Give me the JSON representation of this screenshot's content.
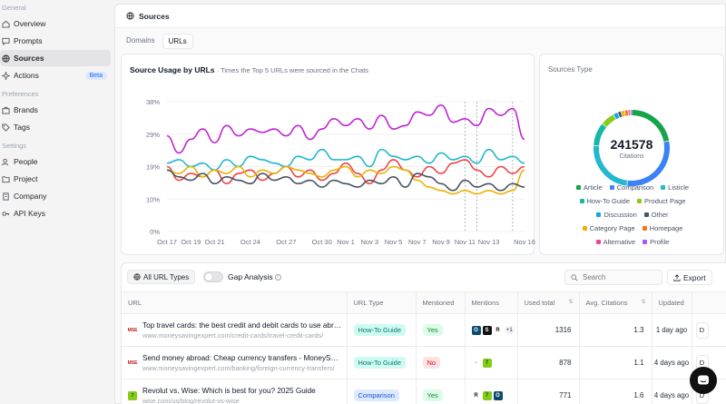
{
  "sidebar": {
    "groups": [
      {
        "label": "General",
        "items": [
          {
            "label": "Overview",
            "icon": "home-icon"
          },
          {
            "label": "Prompts",
            "icon": "chat-icon"
          },
          {
            "label": "Sources",
            "icon": "globe-icon",
            "active": true
          },
          {
            "label": "Actions",
            "icon": "sparkle-icon",
            "badge": "Beta"
          }
        ]
      },
      {
        "label": "Preferences",
        "items": [
          {
            "label": "Brands",
            "icon": "briefcase-icon"
          },
          {
            "label": "Tags",
            "icon": "tag-icon"
          }
        ]
      },
      {
        "label": "Settings",
        "items": [
          {
            "label": "People",
            "icon": "users-icon"
          },
          {
            "label": "Project",
            "icon": "folder-icon"
          },
          {
            "label": "Company",
            "icon": "building-icon"
          },
          {
            "label": "API Keys",
            "icon": "key-icon"
          }
        ]
      }
    ]
  },
  "header": {
    "title": "Sources",
    "icon": "globe-icon"
  },
  "tabs": [
    {
      "label": "Domains"
    },
    {
      "label": "URLs",
      "active": true
    }
  ],
  "usage": {
    "title": "Source Usage by URLs",
    "subtitle": " · Times the Top 5 URLs were sourced in the Chats"
  },
  "chart_data": {
    "type": "line",
    "x": [
      "Oct 17",
      "Oct 18",
      "Oct 19",
      "Oct 20",
      "Oct 21",
      "Oct 22",
      "Oct 23",
      "Oct 24",
      "Oct 25",
      "Oct 26",
      "Oct 27",
      "Oct 28",
      "Oct 29",
      "Oct 30",
      "Oct 31",
      "Nov 1",
      "Nov 2",
      "Nov 3",
      "Nov 4",
      "Nov 5",
      "Nov 6",
      "Nov 7",
      "Nov 8",
      "Nov 9",
      "Nov 10",
      "Nov 11",
      "Nov 12",
      "Nov 13",
      "Nov 14",
      "Nov 15",
      "Nov 16"
    ],
    "xticks": [
      "Oct 17",
      "Oct 19",
      "Oct 21",
      "Oct 24",
      "Oct 27",
      "Oct 30",
      "Nov 1",
      "Nov 3",
      "Nov 5",
      "Nov 7",
      "Nov 9",
      "Nov 11",
      "Nov 13",
      "Nov 16"
    ],
    "yticks": [
      "38%",
      "29%",
      "19%",
      "10%",
      "0%"
    ],
    "ylim": [
      0,
      38
    ],
    "dashed_x": [
      "Nov 11",
      "Nov 12",
      "Nov 15"
    ],
    "series": [
      {
        "color": "#c026d3",
        "values": [
          28,
          23,
          27,
          30,
          26,
          31,
          28,
          30,
          29,
          30,
          28,
          31,
          27,
          30,
          33,
          31,
          33,
          30,
          34,
          30,
          31,
          35,
          34,
          37,
          32,
          33,
          31,
          36,
          34,
          36,
          27
        ]
      },
      {
        "color": "#22b8cf",
        "values": [
          20,
          21,
          19,
          20,
          18,
          21,
          19,
          22,
          21,
          20,
          19,
          22,
          21,
          24,
          21,
          21,
          22,
          19,
          24,
          22,
          21,
          22,
          20,
          23,
          21,
          22,
          20,
          24,
          21,
          22,
          20
        ]
      },
      {
        "color": "#ef4444",
        "values": [
          19,
          15,
          17,
          16,
          18,
          14,
          17,
          18,
          15,
          17,
          19,
          16,
          18,
          15,
          17,
          20,
          17,
          14,
          18,
          21,
          18,
          16,
          19,
          17,
          20,
          21,
          18,
          16,
          19,
          17,
          19
        ]
      },
      {
        "color": "#eab308",
        "values": [
          18,
          17,
          19,
          16,
          18,
          17,
          19,
          16,
          18,
          17,
          19,
          18,
          17,
          16,
          18,
          19,
          16,
          18,
          17,
          19,
          18,
          15,
          13,
          12,
          11,
          12,
          11,
          12,
          11,
          12,
          18
        ]
      },
      {
        "color": "#4b5563",
        "values": [
          18,
          16,
          15,
          17,
          14,
          16,
          15,
          14,
          17,
          15,
          16,
          14,
          15,
          13,
          15,
          14,
          13,
          15,
          14,
          16,
          13,
          17,
          16,
          14,
          12,
          15,
          13,
          14,
          12,
          14,
          13
        ]
      }
    ]
  },
  "sources_type": {
    "title": "Sources Type",
    "total": "241578",
    "total_label": "Citations",
    "segments": [
      {
        "name": "Article",
        "color": "#16a34a",
        "value": 22
      },
      {
        "name": "Comparison",
        "color": "#3b82f6",
        "value": 30
      },
      {
        "name": "Listicle",
        "color": "#22b8cf",
        "value": 24
      },
      {
        "name": "How-To Guide",
        "color": "#14b8a6",
        "value": 10
      },
      {
        "name": "Product Page",
        "color": "#84cc16",
        "value": 6
      },
      {
        "name": "Discussion",
        "color": "#0ea5e9",
        "value": 2
      },
      {
        "name": "Other",
        "color": "#4b5563",
        "value": 1.5
      },
      {
        "name": "Category Page",
        "color": "#eab308",
        "value": 1.5
      },
      {
        "name": "Homepage",
        "color": "#f97316",
        "value": 1.5
      },
      {
        "name": "Alternative",
        "color": "#ec4899",
        "value": 0.8
      },
      {
        "name": "Profile",
        "color": "#a855f7",
        "value": 0.7
      }
    ]
  },
  "table": {
    "all_types_label": "All URL Types",
    "gap_label": "Gap Analysis",
    "search_placeholder": "Search",
    "export_label": "Export",
    "columns": [
      "URL",
      "URL Type",
      "Mentioned",
      "Mentions",
      "Used total",
      "Avg. Citations",
      "Updated"
    ],
    "rows": [
      {
        "favicon": "MSE",
        "favicon_color": "#b91c1c",
        "title": "Top travel cards: the best credit and debit cards to use abroad",
        "url": "www.moneysavingexpert.com/credit-cards/travel-credit-cards/",
        "type": "How-To Guide",
        "type_class": "howto",
        "mentioned": "Yes",
        "mentions": [
          "O",
          "S",
          "R"
        ],
        "more": "+1",
        "used": "1316",
        "avg": "1.3",
        "updated": "1 day ago",
        "last": "D"
      },
      {
        "favicon": "MSE",
        "favicon_color": "#b91c1c",
        "title": "Send money abroad: Cheap currency transfers - MoneySavingExpert",
        "url": "www.moneysavingexpert.com/banking/foreign-currency-transfers/",
        "type": "How-To Guide",
        "type_class": "howto",
        "mentioned": "No",
        "mentions": [
          "-",
          "7"
        ],
        "more": "",
        "used": "878",
        "avg": "1.1",
        "updated": "4 days ago",
        "last": "D"
      },
      {
        "favicon": "7",
        "favicon_color": "#16a34a",
        "title": "Revolut vs. Wise: Which is best for you? 2025 Guide",
        "url": "wise.com/us/blog/revolut-vs-wise",
        "type": "Comparison",
        "type_class": "comp",
        "mentioned": "Yes",
        "mentions": [
          "R",
          "7",
          "O"
        ],
        "more": "",
        "used": "771",
        "avg": "1.6",
        "updated": "4 days ago",
        "last": "D"
      }
    ]
  }
}
